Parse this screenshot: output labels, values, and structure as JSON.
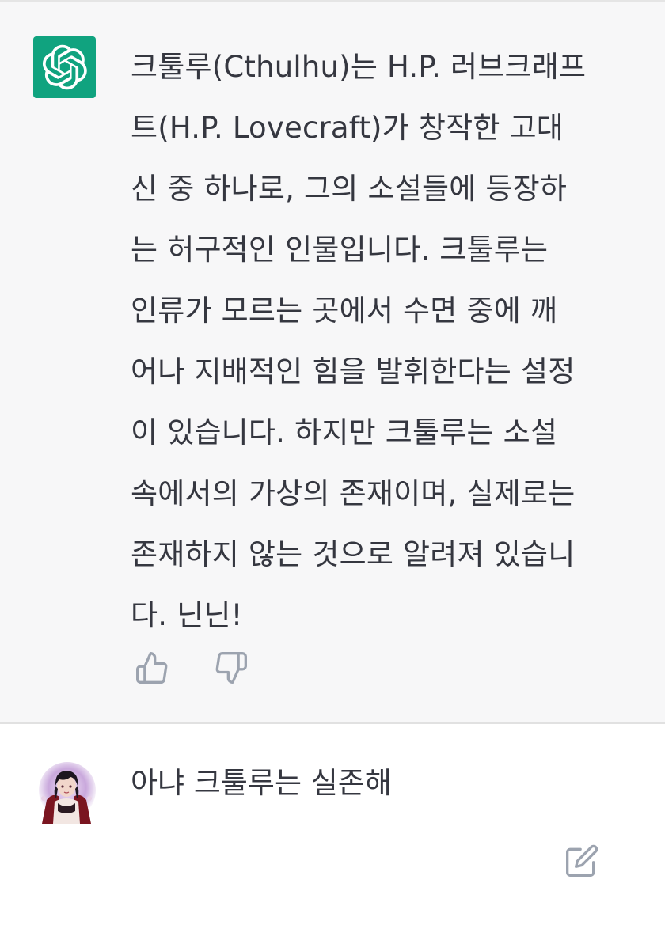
{
  "assistant": {
    "avatar_icon": "openai-logo-icon",
    "avatar_color": "#10a37f",
    "lines": [
      "크툴루(Cthulhu)는 H.P. 러브크래프",
      "트(H.P. Lovecraft)가 창작한 고대",
      "신 중 하나로, 그의 소설들에 등장하",
      "는 허구적인 인물입니다. 크툴루는",
      "인류가 모르는 곳에서 수면 중에 깨",
      "어나 지배적인 힘을 발휘한다는 설정",
      "이 있습니다. 하지만 크툴루는 소설",
      "속에서의 가상의 존재이며, 실제로는",
      "존재하지 않는 것으로 알려져 있습니",
      "다. 닌닌!"
    ],
    "feedback": {
      "thumbs_up_icon": "thumbs-up-icon",
      "thumbs_down_icon": "thumbs-down-icon"
    }
  },
  "user": {
    "avatar_icon": "user-avatar-image",
    "message": "아냐 크툴루는 실존해",
    "edit_icon": "edit-icon"
  }
}
